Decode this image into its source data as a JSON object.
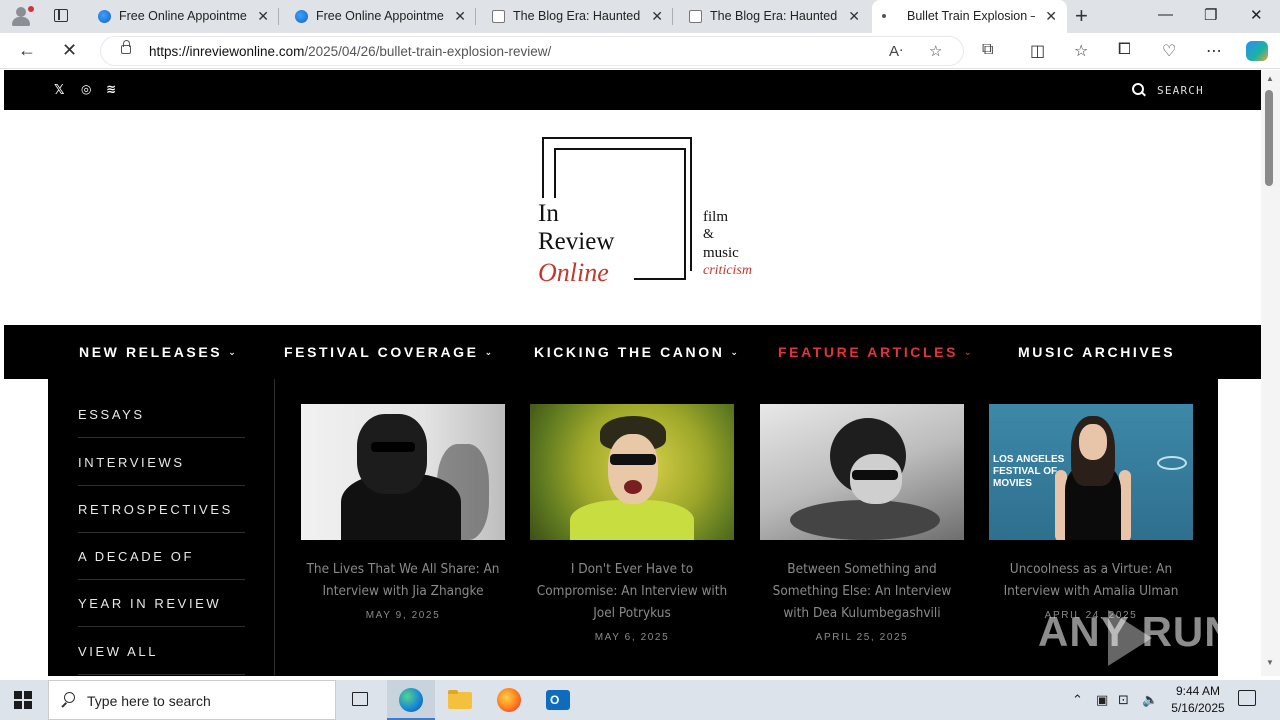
{
  "browser": {
    "tabs": [
      {
        "title": "Free Online Appointment",
        "icon": "edge-icon",
        "active": false
      },
      {
        "title": "Free Online Appointment",
        "icon": "edge-icon",
        "active": false
      },
      {
        "title": "The Blog Era: Haunted H",
        "icon": "page-icon",
        "active": false
      },
      {
        "title": "The Blog Era: Haunted H",
        "icon": "page-icon",
        "active": false
      },
      {
        "title": "Bullet Train Explosion —",
        "icon": "loading-icon",
        "active": true
      }
    ],
    "url_host": "https://inreviewonline.com",
    "url_path": "/2025/04/26/bullet-train-explosion-review/"
  },
  "site": {
    "search_label": "SEARCH",
    "logo": {
      "line1": "In",
      "line2": "Review",
      "line3": "Online",
      "side1": "film",
      "side2": "&",
      "side3": "music",
      "side4": "criticism"
    },
    "nav": [
      {
        "label": "NEW RELEASES",
        "dropdown": true,
        "active": false
      },
      {
        "label": "FESTIVAL COVERAGE",
        "dropdown": true,
        "active": false
      },
      {
        "label": "KICKING THE CANON",
        "dropdown": true,
        "active": false
      },
      {
        "label": "FEATURE ARTICLES",
        "dropdown": true,
        "active": true
      },
      {
        "label": "MUSIC ARCHIVES",
        "dropdown": false,
        "active": false
      }
    ],
    "submenu": [
      "ESSAYS",
      "INTERVIEWS",
      "RETROSPECTIVES",
      "A DECADE OF",
      "YEAR IN REVIEW",
      "VIEW ALL"
    ],
    "cards": [
      {
        "title": "The Lives That We All Share: An Interview with Jia Zhangke",
        "date": "MAY 9, 2025"
      },
      {
        "title": "I Don't Ever Have to Compromise: An Interview with Joel Potrykus",
        "date": "MAY 6, 2025"
      },
      {
        "title": "Between Something and Something Else: An Interview with Dea Kulumbegashvili",
        "date": "APRIL 25, 2025"
      },
      {
        "title": "Uncoolness as a Virtue: An Interview with Amalia Ulman",
        "date": "APRIL 24, 2025"
      }
    ],
    "card4_image_text": "LOS ANGELES\nFESTIVAL OF\nMOVIES",
    "watermark": "ANY RUN"
  },
  "colors": {
    "accent_red": "#e0333c",
    "nav_bg": "#000000"
  },
  "taskbar": {
    "search_placeholder": "Type here to search",
    "time": "9:44 AM",
    "date": "5/16/2025"
  }
}
